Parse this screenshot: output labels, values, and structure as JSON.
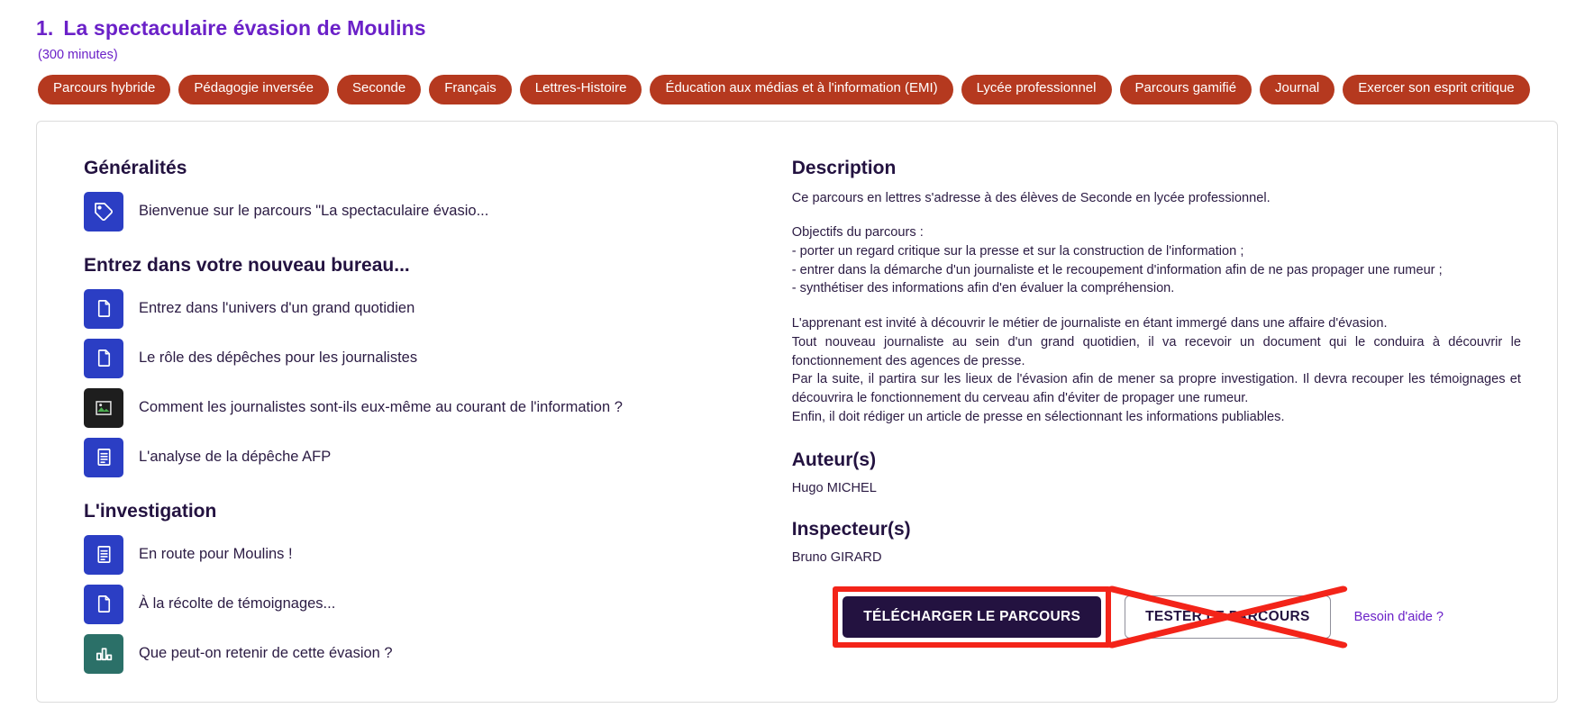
{
  "header": {
    "number": "1.",
    "title": "La spectaculaire évasion de Moulins",
    "duration": "(300 minutes)"
  },
  "tags": [
    "Parcours hybride",
    "Pédagogie inversée",
    "Seconde",
    "Français",
    "Lettres-Histoire",
    "Éducation aux médias et à l'information (EMI)",
    "Lycée professionnel",
    "Parcours gamifié",
    "Journal",
    "Exercer son esprit critique"
  ],
  "left": {
    "sections": [
      {
        "heading": "Généralités",
        "items": [
          {
            "label": "Bienvenue sur le parcours \"La spectaculaire évasio...",
            "icon": "tag-icon",
            "icon_style": "blue"
          }
        ]
      },
      {
        "heading": "Entrez dans votre nouveau bureau...",
        "items": [
          {
            "label": "Entrez dans l'univers d'un grand quotidien",
            "icon": "page-icon",
            "icon_style": "blue"
          },
          {
            "label": "Le rôle des dépêches pour les journalistes",
            "icon": "page-icon",
            "icon_style": "blue"
          },
          {
            "label": "Comment les journalistes sont-ils eux-même au courant de l'information ?",
            "icon": "broken-image-icon",
            "icon_style": "dark"
          },
          {
            "label": "L'analyse de la dépêche AFP",
            "icon": "text-document-icon",
            "icon_style": "blue"
          }
        ]
      },
      {
        "heading": "L'investigation",
        "items": [
          {
            "label": "En route pour Moulins !",
            "icon": "text-document-icon",
            "icon_style": "blue"
          },
          {
            "label": "À la récolte de témoignages...",
            "icon": "page-icon",
            "icon_style": "blue"
          },
          {
            "label": "Que peut-on retenir de cette évasion ?",
            "icon": "bar-chart-icon",
            "icon_style": "teal"
          }
        ]
      }
    ]
  },
  "right": {
    "description_heading": "Description",
    "description_intro": "Ce parcours en lettres s'adresse à des élèves de Seconde en lycée professionnel.",
    "objectives_title": "Objectifs du parcours :",
    "objectives": [
      "- porter un regard critique sur la presse et sur la construction de l'information ;",
      "- entrer dans la démarche d'un journaliste et le recoupement d'information afin de ne pas propager une rumeur ;",
      "- synthétiser des informations afin d'en évaluer la compréhension."
    ],
    "body_paragraphs": [
      "L'apprenant est invité à découvrir le métier de journaliste en étant immergé dans une affaire d'évasion.",
      "Tout nouveau journaliste au sein d'un grand quotidien, il va recevoir un document qui le conduira à découvrir le fonctionnement des agences de presse.",
      "Par la suite, il partira sur les lieux de l'évasion afin de mener sa propre investigation. Il devra recouper les témoignages et découvrira le fonctionnement du cerveau afin d'éviter de propager une rumeur.",
      "Enfin, il doit rédiger un article de presse en sélectionnant les informations publiables."
    ],
    "authors_heading": "Auteur(s)",
    "authors": "Hugo MICHEL",
    "inspectors_heading": "Inspecteur(s)",
    "inspectors": "Bruno GIRARD"
  },
  "actions": {
    "download_label": "TÉLÉCHARGER LE PARCOURS",
    "test_label": "TESTER LE PARCOURS",
    "help_label": "Besoin d'aide ?"
  },
  "colors": {
    "title_purple": "#6b21c8",
    "tag_red": "#b5391f",
    "icon_blue": "#2b3ec4",
    "icon_dark": "#1e1e1e",
    "icon_teal": "#2b7068",
    "button_dark": "#231240",
    "annotation_red": "#f32419"
  }
}
